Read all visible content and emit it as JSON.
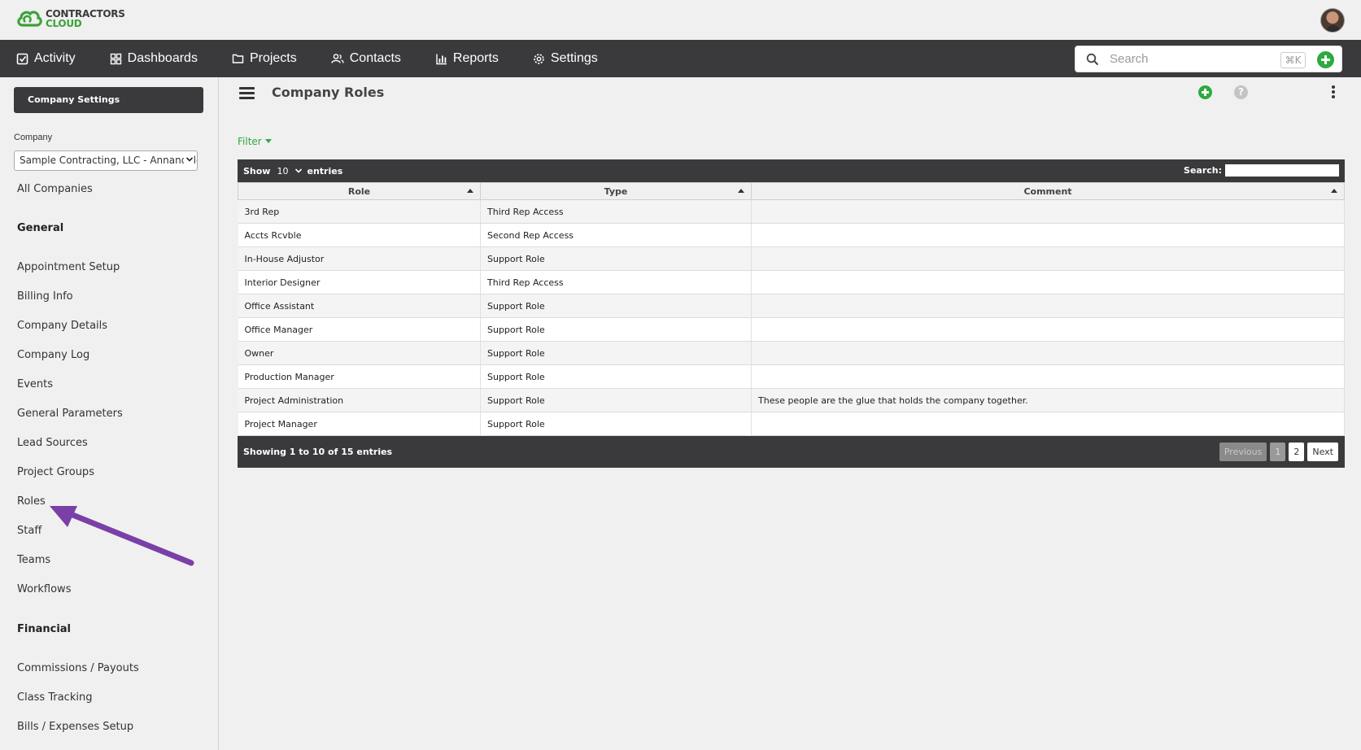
{
  "brand": {
    "line1": "CONTRACTORS",
    "line2": "CLOUD",
    "green": "#2eaa3f",
    "dark": "#3a3a3c"
  },
  "nav": {
    "items": [
      {
        "label": "Activity",
        "icon": "checkbox-icon"
      },
      {
        "label": "Dashboards",
        "icon": "grid-icon"
      },
      {
        "label": "Projects",
        "icon": "folder-icon"
      },
      {
        "label": "Contacts",
        "icon": "users-icon"
      },
      {
        "label": "Reports",
        "icon": "bar-chart-icon"
      },
      {
        "label": "Settings",
        "icon": "gear-icon"
      }
    ],
    "search_placeholder": "Search",
    "shortcut": "⌘K"
  },
  "sidebar": {
    "company_settings_label": "Company Settings",
    "company_label": "Company",
    "company_value": "Sample Contracting, LLC - Annandale",
    "all_companies": "All Companies",
    "general_heading": "General",
    "general_items": [
      "Appointment Setup",
      "Billing Info",
      "Company Details",
      "Company Log",
      "Events",
      "General Parameters",
      "Lead Sources",
      "Project Groups",
      "Roles",
      "Staff",
      "Teams",
      "Workflows"
    ],
    "financial_heading": "Financial",
    "financial_items": [
      "Commissions / Payouts",
      "Class Tracking",
      "Bills / Expenses Setup"
    ]
  },
  "main": {
    "title": "Company Roles",
    "filter_label": "Filter",
    "table": {
      "show_label": "Show",
      "length_value": "10",
      "entries_label": "entries",
      "search_label": "Search:",
      "columns": [
        "Role",
        "Type",
        "Comment"
      ],
      "rows": [
        [
          "3rd Rep",
          "Third Rep Access",
          ""
        ],
        [
          "Accts Rcvble",
          "Second Rep Access",
          ""
        ],
        [
          "In-House Adjustor",
          "Support Role",
          ""
        ],
        [
          "Interior Designer",
          "Third Rep Access",
          ""
        ],
        [
          "Office Assistant",
          "Support Role",
          ""
        ],
        [
          "Office Manager",
          "Support Role",
          ""
        ],
        [
          "Owner",
          "Support Role",
          ""
        ],
        [
          "Production Manager",
          "Support Role",
          ""
        ],
        [
          "Project Administration",
          "Support Role",
          "These people are the glue that holds the company together."
        ],
        [
          "Project Manager",
          "Support Role",
          ""
        ]
      ],
      "info": "Showing 1 to 10 of 15 entries",
      "pager": {
        "previous": "Previous",
        "page1": "1",
        "page2": "2",
        "next": "Next"
      }
    }
  },
  "annotation": {
    "arrow_color": "#7b3fa8",
    "points_to": "Roles"
  }
}
